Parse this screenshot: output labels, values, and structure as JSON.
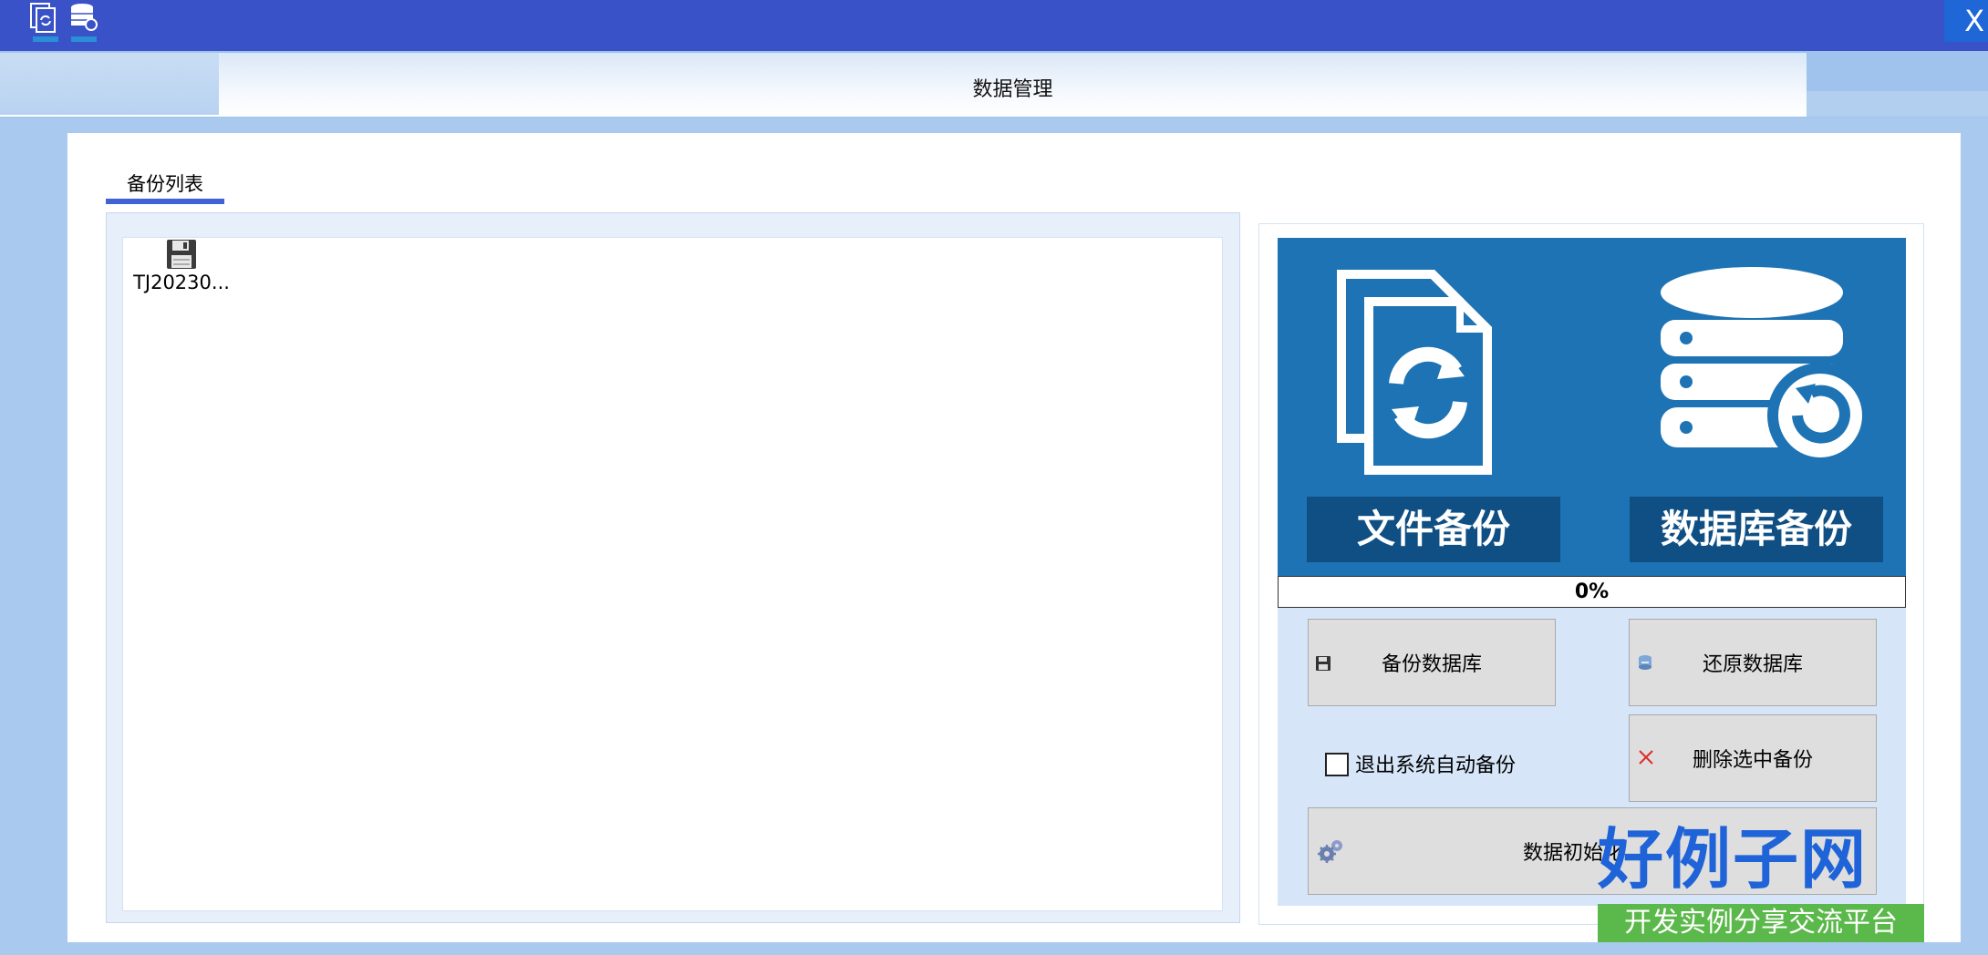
{
  "window": {
    "close_label": "X",
    "toolbar_icons": [
      "file-backup-icon",
      "database-backup-icon"
    ]
  },
  "header": {
    "title": "数据管理"
  },
  "tabs": [
    {
      "label": "备份列表",
      "active": true
    }
  ],
  "backup_list": {
    "items": [
      {
        "name": "TJ20230...",
        "icon": "floppy-disk-icon"
      }
    ]
  },
  "banner": {
    "file_backup_label": "文件备份",
    "database_backup_label": "数据库备份",
    "background_color": "#1d73b3"
  },
  "progress": {
    "value": 0,
    "text": "0%"
  },
  "actions": {
    "backup_db": "备份数据库",
    "restore_db": "还原数据库",
    "auto_backup_label": "退出系统自动备份",
    "auto_backup_checked": false,
    "delete_selected": "删除选中备份",
    "init_data": "数据初始化......"
  },
  "watermark": {
    "brand": "好例子网",
    "tagline": "开发实例分享交流平台"
  },
  "colors": {
    "titlebar": "#3a52c8",
    "accent": "#3f62d6"
  }
}
